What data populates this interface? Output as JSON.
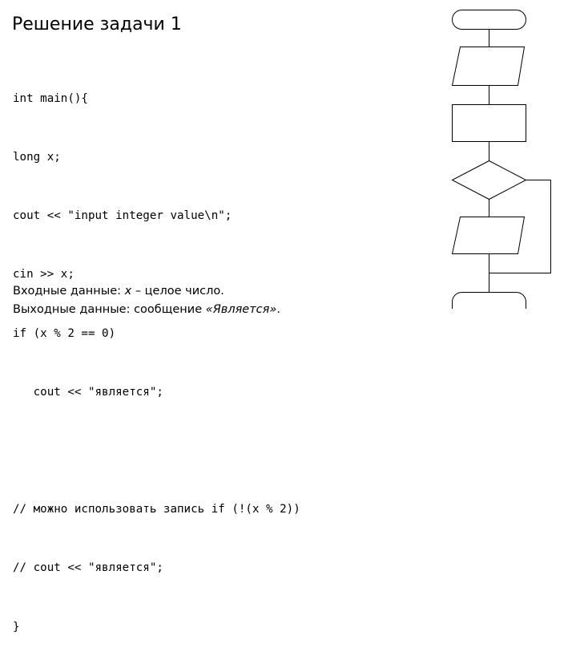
{
  "title": "Решение задачи 1",
  "code_lines": [
    "int main(){",
    "long x;",
    "cout << \"input integer value\\n\";",
    "cin >> x;",
    "if (x % 2 == 0)",
    "   cout << \"является\";",
    "",
    "// можно использовать запись if (!(x % 2))",
    "// cout << \"является\";",
    "}"
  ],
  "io": {
    "input_label": "Входные данные: ",
    "input_var": "x",
    "input_rest": " – целое число.",
    "output_label": "Выходные данные: сообщение ",
    "output_value": "«Является»",
    "output_end": "."
  },
  "flowchart": {
    "blocks": [
      "terminator-start",
      "input-parallelogram",
      "process-rectangle",
      "decision-diamond",
      "output-parallelogram",
      "terminator-end"
    ]
  }
}
